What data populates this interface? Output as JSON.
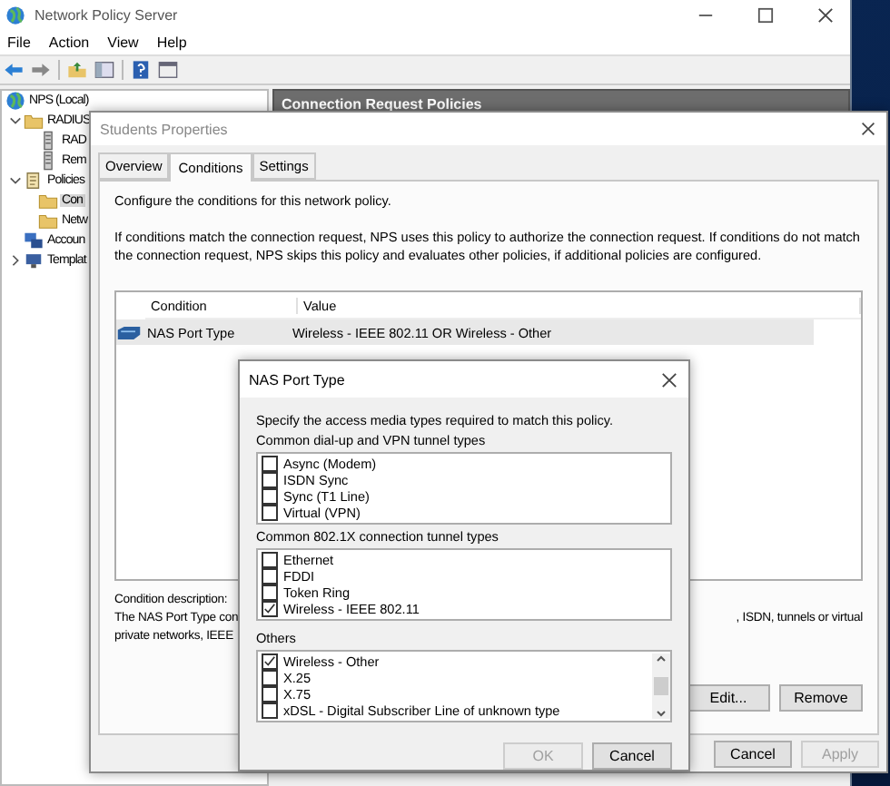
{
  "main_window": {
    "title": "Network Policy Server",
    "menu": [
      "File",
      "Action",
      "View",
      "Help"
    ],
    "tree": [
      {
        "label": "NPS (Local)",
        "kind": "root",
        "selected": false,
        "children": [
          {
            "label": "RADIUS",
            "kind": "folder",
            "selected": false,
            "expanded": true,
            "children": [
              {
                "label": "RAD",
                "kind": "server",
                "selected": false
              },
              {
                "label": "Rem",
                "kind": "server",
                "selected": false
              }
            ]
          },
          {
            "label": "Policies",
            "kind": "policies",
            "selected": false,
            "expanded": true,
            "children": [
              {
                "label": "Con",
                "kind": "folder",
                "selected": true
              },
              {
                "label": "Netw",
                "kind": "folder",
                "selected": false
              }
            ]
          },
          {
            "label": "Accoun",
            "kind": "accounting",
            "selected": false
          },
          {
            "label": "Templat",
            "kind": "templates",
            "selected": false,
            "expanded": false
          }
        ]
      }
    ],
    "pane_header": "Connection Request Policies"
  },
  "properties_dialog": {
    "title": "Students Properties",
    "tabs": [
      {
        "label": "Overview",
        "selected": false
      },
      {
        "label": "Conditions",
        "selected": true
      },
      {
        "label": "Settings",
        "selected": false
      }
    ],
    "intro": "Configure the conditions for this network policy.",
    "paragraph": "If conditions match the connection request, NPS uses this policy to authorize the connection request. If conditions do not match the connection request, NPS skips this policy and evaluates other policies, if additional policies are configured.",
    "columns": [
      "Condition",
      "Value"
    ],
    "rows": [
      {
        "condition": "NAS Port Type",
        "value": "Wireless - IEEE 802.11 OR Wireless - Other",
        "selected": true
      }
    ],
    "description_label": "Condition description:",
    "description_left": [
      "The NAS Port Type con",
      "private networks, IEEE"
    ],
    "description_right": ", ISDN, tunnels or virtual",
    "list_buttons": [
      {
        "label": "Edit...",
        "disabled": false
      },
      {
        "label": "Remove",
        "disabled": false
      }
    ],
    "buttons": [
      {
        "label": "Cancel",
        "disabled": false
      },
      {
        "label": "Apply",
        "disabled": true
      }
    ]
  },
  "nas_dialog": {
    "title": "NAS Port Type",
    "instruction": "Specify the access media types required to match this policy.",
    "groups": [
      {
        "label": "Common dial-up and VPN tunnel types",
        "scrollable": false,
        "items": [
          {
            "label": "Async (Modem)",
            "checked": false
          },
          {
            "label": "ISDN Sync",
            "checked": false
          },
          {
            "label": "Sync (T1 Line)",
            "checked": false
          },
          {
            "label": "Virtual (VPN)",
            "checked": false
          }
        ]
      },
      {
        "label": "Common 802.1X connection tunnel types",
        "scrollable": false,
        "items": [
          {
            "label": "Ethernet",
            "checked": false
          },
          {
            "label": "FDDI",
            "checked": false
          },
          {
            "label": "Token Ring",
            "checked": false
          },
          {
            "label": "Wireless - IEEE 802.11",
            "checked": true
          }
        ]
      },
      {
        "label": "Others",
        "scrollable": true,
        "items": [
          {
            "label": "Wireless - Other",
            "checked": true
          },
          {
            "label": "X.25",
            "checked": false
          },
          {
            "label": "X.75",
            "checked": false
          },
          {
            "label": "xDSL - Digital Subscriber Line of unknown type",
            "checked": false
          }
        ]
      }
    ],
    "buttons": [
      {
        "label": "OK",
        "disabled": true
      },
      {
        "label": "Cancel",
        "disabled": false
      }
    ]
  }
}
